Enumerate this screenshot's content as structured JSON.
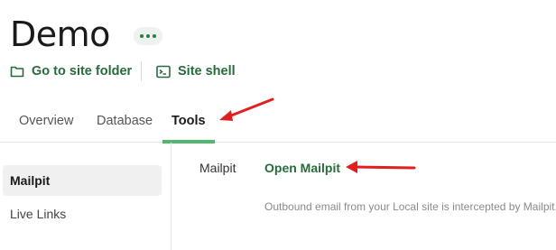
{
  "header": {
    "site_title": "Demo",
    "more_icon": "ellipsis-icon",
    "actions": [
      {
        "label": "Go to site folder",
        "icon": "folder-icon"
      },
      {
        "label": "Site shell",
        "icon": "terminal-icon"
      }
    ]
  },
  "tabs": {
    "items": [
      {
        "label": "Overview"
      },
      {
        "label": "Database"
      },
      {
        "label": "Tools"
      }
    ],
    "active": "Tools"
  },
  "sidebar": {
    "items": [
      {
        "label": "Mailpit",
        "selected": true
      },
      {
        "label": "Live Links",
        "selected": false
      }
    ]
  },
  "tool": {
    "label": "Mailpit",
    "link_label": "Open Mailpit",
    "description": "Outbound email from your Local site is intercepted by Mailpit."
  },
  "annotations": {
    "arrow_color": "#e02020",
    "arrows": [
      "arrow-to-tools-tab",
      "arrow-to-open-mailpit"
    ]
  },
  "colors": {
    "accent_green": "#276b3d",
    "tab_indicator": "#51b86d"
  }
}
